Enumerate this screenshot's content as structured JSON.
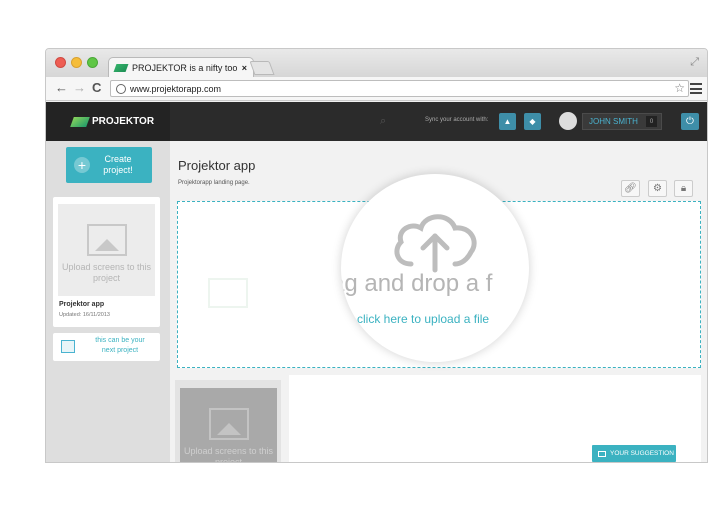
{
  "browser": {
    "tab_title": "PROJEKTOR is a nifty tool to",
    "tab_close": "×",
    "url": "www.projektorapp.com"
  },
  "header": {
    "logo_text": "PROJEKTOR",
    "sync_label": "Sync your account with:",
    "user_name": "JOHN SMITH",
    "user_count": "0"
  },
  "sidebar": {
    "create_label": "Create project!",
    "project": {
      "placeholder": "Upload screens to this project",
      "name": "Projektor app",
      "updated": "Updated: 16/11/2013"
    },
    "next_project": "this can be your next project"
  },
  "main": {
    "title": "Projektor app",
    "subtitle": "Projektorapp landing page.",
    "dropzone_main": "rag and drop a f",
    "dropzone_link": "or click here to upload a file",
    "second_placeholder": "Upload screens to this project",
    "suggestion_button": "YOUR SUGGESTION"
  },
  "colors": {
    "accent": "#3bb2c1",
    "header_bg": "#2b2b2b"
  },
  "icons": [
    "link-icon",
    "gear-icon",
    "lock-icon",
    "cloud-upload-icon",
    "image-icon",
    "power-icon",
    "search-icon"
  ]
}
